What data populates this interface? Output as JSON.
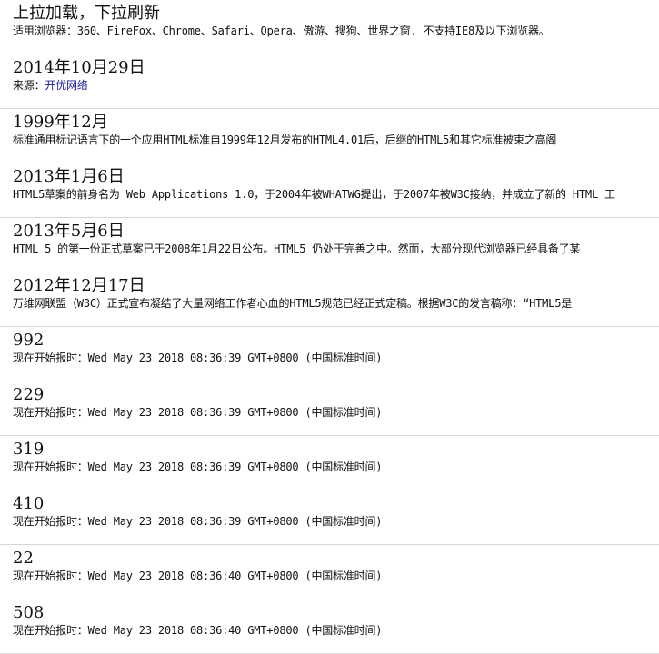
{
  "header": {
    "title": "上拉加载，下拉刷新",
    "description": "适用浏览器：360、FireFox、Chrome、Safari、Opera、傲游、搜狗、世界之窗. 不支持IE8及以下浏览器。"
  },
  "items": [
    {
      "title": "2014年10月29日",
      "desc_prefix": "来源：",
      "desc_link": "开优网络"
    },
    {
      "title": "1999年12月",
      "desc": "标准通用标记语言下的一个应用HTML标准自1999年12月发布的HTML4.01后，后继的HTML5和其它标准被束之高阁"
    },
    {
      "title": "2013年1月6日",
      "desc": "HTML5草案的前身名为 Web Applications 1.0，于2004年被WHATWG提出，于2007年被W3C接纳，并成立了新的 HTML 工"
    },
    {
      "title": "2013年5月6日",
      "desc": "HTML 5 的第一份正式草案已于2008年1月22日公布。HTML5 仍处于完善之中。然而，大部分现代浏览器已经具备了某"
    },
    {
      "title": "2012年12月17日",
      "desc": "万维网联盟（W3C）正式宣布凝结了大量网络工作者心血的HTML5规范已经正式定稿。根据W3C的发言稿称：“HTML5是"
    },
    {
      "title": "992",
      "desc": "现在开始报时：Wed May 23 2018 08:36:39 GMT+0800 (中国标准时间)"
    },
    {
      "title": "229",
      "desc": "现在开始报时：Wed May 23 2018 08:36:39 GMT+0800 (中国标准时间)"
    },
    {
      "title": "319",
      "desc": "现在开始报时：Wed May 23 2018 08:36:39 GMT+0800 (中国标准时间)"
    },
    {
      "title": "410",
      "desc": "现在开始报时：Wed May 23 2018 08:36:39 GMT+0800 (中国标准时间)"
    },
    {
      "title": "22",
      "desc": "现在开始报时：Wed May 23 2018 08:36:40 GMT+0800 (中国标准时间)"
    },
    {
      "title": "508",
      "desc": "现在开始报时：Wed May 23 2018 08:36:40 GMT+0800 (中国标准时间)"
    }
  ]
}
